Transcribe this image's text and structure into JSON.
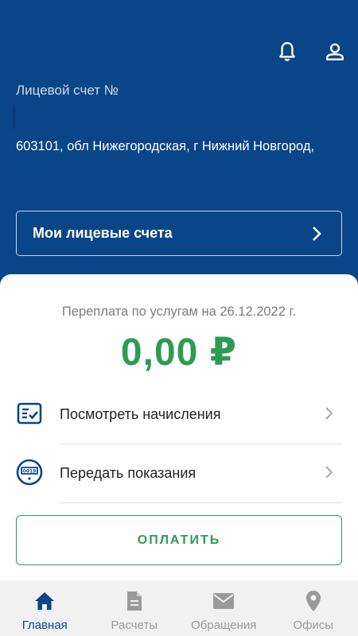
{
  "header": {
    "account_label": "Лицевой счет №",
    "address": "603101, обл Нижегородская, г Нижний Новгород,",
    "icons": [
      "bell-icon",
      "user-icon"
    ],
    "accounts_button": "Мои лицевые счета"
  },
  "summary": {
    "overpay_text": "Переплата по услугам на 26.12.2022 г.",
    "amount": "0,00 ₽",
    "amount_color": "#2e9b55"
  },
  "menu": [
    {
      "label": "Посмотреть начисления",
      "icon": "invoice-check-icon"
    },
    {
      "label": "Передать показания",
      "icon": "meter-icon"
    }
  ],
  "pay_button": "ОПЛАТИТЬ",
  "bottom_nav": [
    {
      "label": "Главная",
      "icon": "home-icon",
      "active": true
    },
    {
      "label": "Расчеты",
      "icon": "document-icon",
      "active": false
    },
    {
      "label": "Обращения",
      "icon": "mail-icon",
      "active": false
    },
    {
      "label": "Офисы",
      "icon": "location-pin-icon",
      "active": false
    }
  ],
  "colors": {
    "brand": "#0a4588",
    "accent": "#2e9b55"
  }
}
